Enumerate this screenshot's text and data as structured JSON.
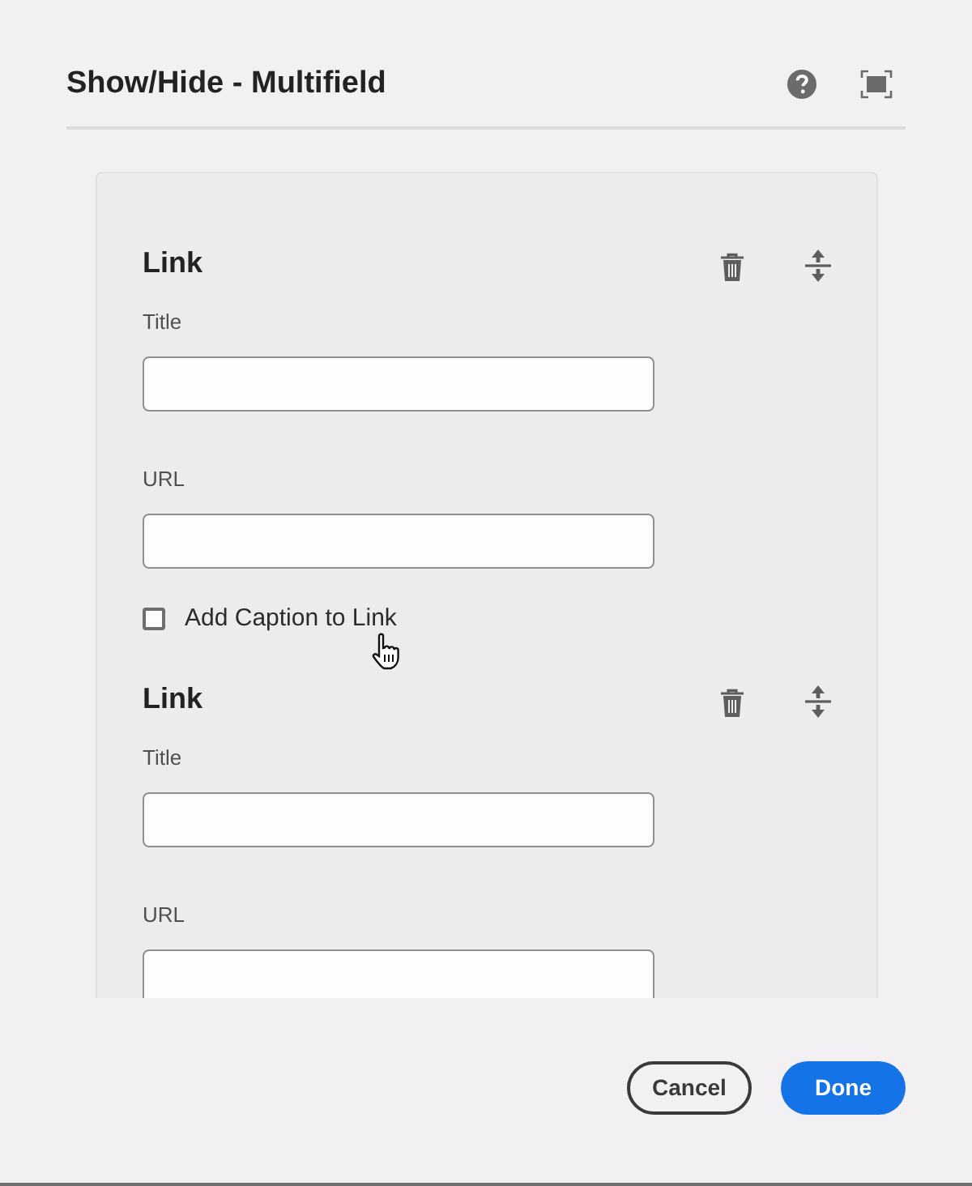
{
  "dialog": {
    "title": "Show/Hide - Multifield"
  },
  "items": [
    {
      "heading": "Link",
      "fields": [
        {
          "label": "Title"
        },
        {
          "label": "URL"
        }
      ],
      "checkbox": {
        "label": "Add Caption to Link",
        "checked": false
      }
    },
    {
      "heading": "Link",
      "fields": [
        {
          "label": "Title"
        },
        {
          "label": "URL"
        }
      ]
    }
  ],
  "buttons": [
    {
      "label": "Cancel",
      "kind": "secondary"
    },
    {
      "label": "Done",
      "kind": "primary"
    }
  ]
}
